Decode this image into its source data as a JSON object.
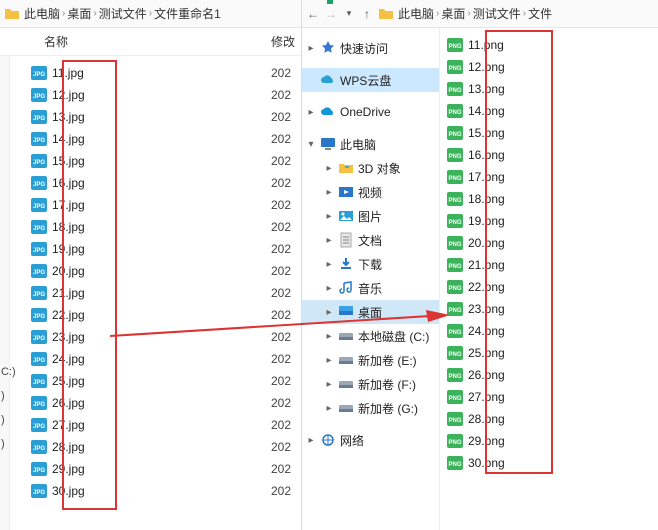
{
  "left_window": {
    "breadcrumb": [
      "此电脑",
      "桌面",
      "测试文件",
      "文件重命名1"
    ],
    "columns": {
      "name": "名称",
      "modified": "修改"
    },
    "files": [
      {
        "name": "11.jpg",
        "mod": "202"
      },
      {
        "name": "12.jpg",
        "mod": "202"
      },
      {
        "name": "13.jpg",
        "mod": "202"
      },
      {
        "name": "14.jpg",
        "mod": "202"
      },
      {
        "name": "15.jpg",
        "mod": "202"
      },
      {
        "name": "16.jpg",
        "mod": "202"
      },
      {
        "name": "17.jpg",
        "mod": "202"
      },
      {
        "name": "18.jpg",
        "mod": "202"
      },
      {
        "name": "19.jpg",
        "mod": "202"
      },
      {
        "name": "20.jpg",
        "mod": "202"
      },
      {
        "name": "21.jpg",
        "mod": "202"
      },
      {
        "name": "22.jpg",
        "mod": "202"
      },
      {
        "name": "23.jpg",
        "mod": "202"
      },
      {
        "name": "24.jpg",
        "mod": "202"
      },
      {
        "name": "25.jpg",
        "mod": "202"
      },
      {
        "name": "26.jpg",
        "mod": "202"
      },
      {
        "name": "27.jpg",
        "mod": "202"
      },
      {
        "name": "28.jpg",
        "mod": "202"
      },
      {
        "name": "29.jpg",
        "mod": "202"
      },
      {
        "name": "30.jpg",
        "mod": "202"
      }
    ],
    "left_stub": [
      "C:)",
      ")",
      ")",
      ")"
    ]
  },
  "right_window": {
    "breadcrumb": [
      "此电脑",
      "桌面",
      "测试文件",
      "文件"
    ],
    "tree": [
      {
        "label": "快速访问",
        "icon": "star",
        "caret": ">",
        "level": 0
      },
      {
        "label": "WPS云盘",
        "icon": "wps",
        "caret": "",
        "level": 0,
        "sel": true
      },
      {
        "label": "OneDrive",
        "icon": "onedrive",
        "caret": ">",
        "level": 0
      },
      {
        "label": "此电脑",
        "icon": "monitor",
        "caret": "v",
        "level": 0
      },
      {
        "label": "3D 对象",
        "icon": "folder3d",
        "caret": ">",
        "level": 1
      },
      {
        "label": "视频",
        "icon": "video",
        "caret": ">",
        "level": 1
      },
      {
        "label": "图片",
        "icon": "picture",
        "caret": ">",
        "level": 1
      },
      {
        "label": "文档",
        "icon": "doc",
        "caret": ">",
        "level": 1
      },
      {
        "label": "下载",
        "icon": "download",
        "caret": ">",
        "level": 1
      },
      {
        "label": "音乐",
        "icon": "music",
        "caret": ">",
        "level": 1
      },
      {
        "label": "桌面",
        "icon": "desktop",
        "caret": ">",
        "level": 1,
        "sel2": true
      },
      {
        "label": "本地磁盘 (C:)",
        "icon": "drive",
        "caret": ">",
        "level": 1
      },
      {
        "label": "新加卷 (E:)",
        "icon": "drive",
        "caret": ">",
        "level": 1
      },
      {
        "label": "新加卷 (F:)",
        "icon": "drive",
        "caret": ">",
        "level": 1
      },
      {
        "label": "新加卷 (G:)",
        "icon": "drive",
        "caret": ">",
        "level": 1
      },
      {
        "label": "网络",
        "icon": "net",
        "caret": ">",
        "level": 0
      }
    ],
    "files": [
      "11.png",
      "12.png",
      "13.png",
      "14.png",
      "15.png",
      "16.png",
      "17.png",
      "18.png",
      "19.png",
      "20.png",
      "21.png",
      "22.png",
      "23.png",
      "24.png",
      "25.png",
      "26.png",
      "27.png",
      "28.png",
      "29.png",
      "30.png"
    ]
  }
}
